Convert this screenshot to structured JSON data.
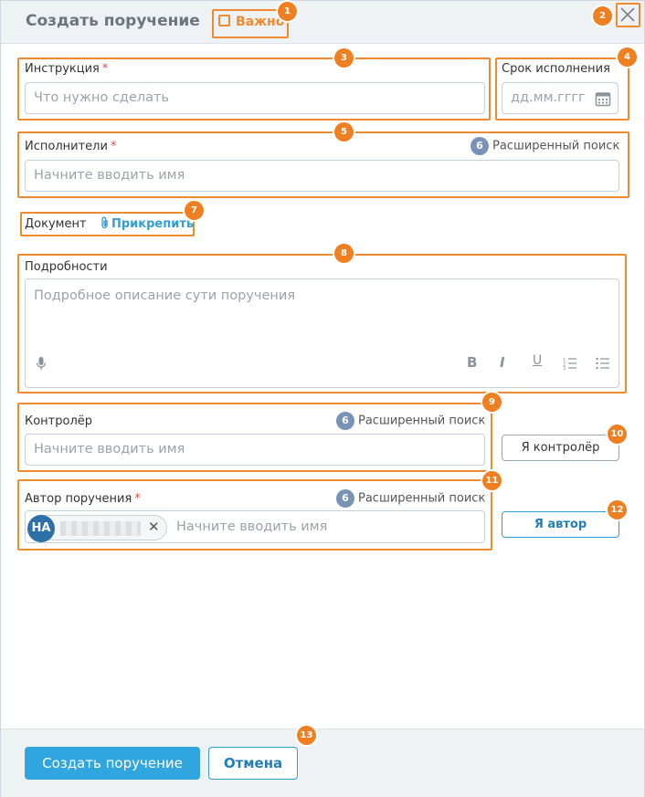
{
  "dialog": {
    "title": "Создать поручение",
    "important_label": "Важно",
    "close_glyph": "✕"
  },
  "badges": {
    "b1": "1",
    "b2": "2",
    "b3": "3",
    "b4": "4",
    "b5": "5",
    "b6": "6",
    "b7": "7",
    "b8": "8",
    "b9": "9",
    "b10": "10",
    "b11": "11",
    "b12": "12",
    "b13": "13"
  },
  "form": {
    "required_mark": "*",
    "instruction": {
      "label": "Инструкция",
      "placeholder": "Что нужно сделать"
    },
    "deadline": {
      "label": "Срок исполнения",
      "placeholder": "дд.мм.гггг",
      "icon": "calendar-icon"
    },
    "executors": {
      "label": "Исполнители",
      "placeholder": "Начните вводить имя",
      "advanced_search": "Расширенный поиск",
      "search_badge": "6"
    },
    "document": {
      "label": "Документ",
      "attach": "Прикрепить",
      "icon": "paperclip-icon"
    },
    "details": {
      "label": "Подробности",
      "placeholder": "Подробное описание сути поручения",
      "toolbar": {
        "bold": "B",
        "italic": "I",
        "underline": "U"
      }
    },
    "controller": {
      "label": "Контролёр",
      "placeholder": "Начните вводить имя",
      "advanced_search": "Расширенный поиск",
      "search_badge": "6",
      "self_button": "Я контролёр"
    },
    "author": {
      "label": "Автор поручения",
      "placeholder": "Начните вводить имя",
      "advanced_search": "Расширенный поиск",
      "search_badge": "6",
      "self_button": "Я автор",
      "chip": {
        "initials": "НА",
        "remove": "✕"
      }
    }
  },
  "footer": {
    "submit": "Создать поручение",
    "cancel": "Отмена"
  },
  "colors": {
    "accent": "#31a5dd",
    "highlight": "#f08a2e",
    "badge": "#f07f22",
    "search_badge": "#7892b8",
    "required": "#e04b4b",
    "avatar": "#2d70a8"
  }
}
